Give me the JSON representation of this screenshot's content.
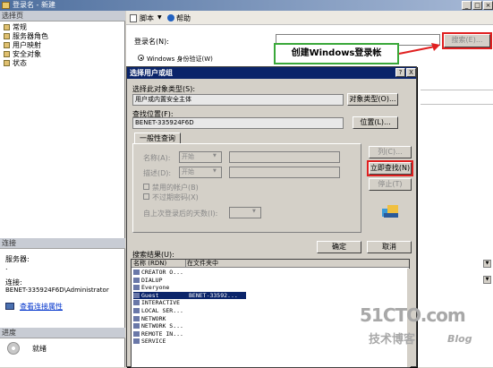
{
  "window": {
    "title": "登录名 - 新建",
    "btn_min": "_",
    "btn_max": "□",
    "btn_close": "×"
  },
  "left": {
    "select_page_header": "选择页",
    "pages": [
      "常规",
      "服务器角色",
      "用户映射",
      "安全对象",
      "状态"
    ],
    "connection_header": "连接",
    "server_label": "服务器:",
    "server_value": ".",
    "connection_label": "连接:",
    "connection_value": "BENET-335924F6D\\Administrator",
    "view_props_link": "查看连接属性",
    "progress_header": "进度",
    "progress_status": "就绪"
  },
  "toolbar": {
    "script_label": "脚本",
    "help_label": "帮助"
  },
  "main": {
    "login_name_label": "登录名(N):",
    "search_button": "搜索(E)...",
    "windows_auth_label": "Windows 身份验证(W)",
    "help_label": "帮助"
  },
  "callout_text": "创建Windows登录帐",
  "dialog": {
    "title": "选择用户或组",
    "help_btn": "?",
    "close_btn": "X",
    "object_type_label": "选择此对象类型(S):",
    "object_type_value": "用户或内置安全主体",
    "object_type_button": "对象类型(O)...",
    "location_label": "查找位置(F):",
    "location_value": "BENET-335924F6D",
    "location_button": "位置(L)...",
    "tab_label": "一般性查询",
    "name_label": "名称(A):",
    "desc_label": "描述(D):",
    "starts_with": "开始",
    "disabled_accounts": "禁用的帐户(B)",
    "no_expire": "不过期密码(X)",
    "days_since_logon": "自上次登录后的天数(I):",
    "columns_button": "列(C)...",
    "find_now_button": "立即查找(N)",
    "stop_button": "停止(T)",
    "ok_button": "确定",
    "cancel_button": "取消",
    "results_label": "搜索结果(U):",
    "col_name": "名称 (RDN)",
    "col_folder": "在文件夹中",
    "results": [
      {
        "name": "CREATOR O...",
        "folder": ""
      },
      {
        "name": "DIALUP",
        "folder": ""
      },
      {
        "name": "Everyone",
        "folder": ""
      },
      {
        "name": "Guest",
        "folder": "BENET-33592..."
      },
      {
        "name": "INTERACTIVE",
        "folder": ""
      },
      {
        "name": "LOCAL SER...",
        "folder": ""
      },
      {
        "name": "NETWORK",
        "folder": ""
      },
      {
        "name": "NETWORK S...",
        "folder": ""
      },
      {
        "name": "REMOTE IN...",
        "folder": ""
      },
      {
        "name": "SERVICE",
        "folder": ""
      }
    ]
  },
  "watermark": {
    "big": "51CTO.com",
    "sub": "技术博客",
    "blog": "Blog"
  }
}
